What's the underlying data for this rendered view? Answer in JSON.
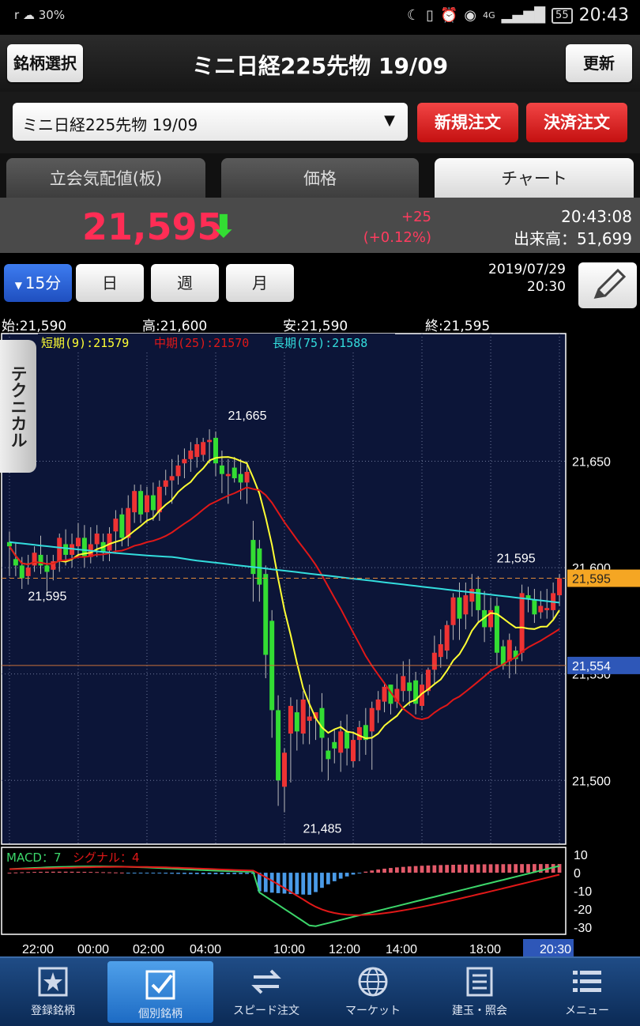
{
  "status": {
    "left": "30%",
    "time": "20:43",
    "battery": "55",
    "net": "4G"
  },
  "header": {
    "left_button": "銘柄選択",
    "title": "ミニ日経225先物 19/09",
    "right_button": "更新"
  },
  "order": {
    "symbol": "ミニ日経225先物 19/09",
    "new_order": "新規注文",
    "settle_order": "決済注文"
  },
  "tabs": [
    {
      "label": "立会気配値(板)"
    },
    {
      "label": "価格"
    },
    {
      "label": "チャート"
    }
  ],
  "quote": {
    "price": "21,595",
    "change": "+25",
    "change_pct": "(+0.12%)",
    "time": "20:43:08",
    "volume": "出来高：51,699"
  },
  "period_buttons": [
    {
      "label": "15分"
    },
    {
      "label": "日"
    },
    {
      "label": "週"
    },
    {
      "label": "月"
    }
  ],
  "chart_date": "2019/07/29",
  "chart_time": "20:30",
  "ohlc": {
    "open": "始:21,590",
    "high": "高:21,600",
    "low": "安:21,590",
    "close": "終:21,595"
  },
  "technical_tab": "テクニカル",
  "legend": {
    "short": "短期(9):21579",
    "mid": "中期(25):21570",
    "long": "長期(75):21588"
  },
  "macd_legend": {
    "macd": "MACD：7",
    "signal": "シグナル：4"
  },
  "colors": {
    "short": "#ffff33",
    "mid": "#e01818",
    "long": "#33dddd",
    "up": "#ee3333",
    "down": "#33dd33",
    "bg": "#0c1538"
  },
  "chart_data": {
    "type": "candlestick",
    "ylim": [
      21470,
      21710
    ],
    "y_ticks": [
      "21,500",
      "21,550",
      "21,600",
      "21,650"
    ],
    "x_ticks": [
      "22:00",
      "00:00",
      "02:00",
      "04:00",
      "10:00",
      "12:00",
      "14:00",
      "18:00",
      "20:30"
    ],
    "current_price_label": "21,595",
    "marker_label": "21,554",
    "annotations": [
      {
        "text": "21,665",
        "x": 38,
        "y": 21665
      },
      {
        "text": "21,595",
        "x": 6,
        "y": 21595
      },
      {
        "text": "21,485",
        "x": 50,
        "y": 21485
      },
      {
        "text": "21,595",
        "x": 81,
        "y": 21598
      }
    ],
    "macd_ticks": [
      "10",
      "0",
      "-10",
      "-20",
      "-30"
    ],
    "candles": [
      [
        21612,
        21610,
        21617,
        21596
      ],
      [
        21604,
        21601,
        21612,
        21596
      ],
      [
        21601,
        21595,
        21605,
        21590
      ],
      [
        21596,
        21600,
        21606,
        21592
      ],
      [
        21601,
        21607,
        21610,
        21598
      ],
      [
        21606,
        21601,
        21615,
        21597
      ],
      [
        21601,
        21598,
        21606,
        21589
      ],
      [
        21599,
        21603,
        21606,
        21594
      ],
      [
        21603,
        21614,
        21616,
        21598
      ],
      [
        21611,
        21606,
        21618,
        21601
      ],
      [
        21606,
        21611,
        21616,
        21600
      ],
      [
        21610,
        21614,
        21621,
        21605
      ],
      [
        21614,
        21605,
        21620,
        21600
      ],
      [
        21605,
        21611,
        21619,
        21602
      ],
      [
        21611,
        21616,
        21620,
        21605
      ],
      [
        21612,
        21607,
        21616,
        21603
      ],
      [
        21608,
        21616,
        21619,
        21603
      ],
      [
        21617,
        21623,
        21627,
        21607
      ],
      [
        21625,
        21614,
        21628,
        21610
      ],
      [
        21614,
        21628,
        21634,
        21610
      ],
      [
        21626,
        21636,
        21639,
        21621
      ],
      [
        21636,
        21625,
        21639,
        21621
      ],
      [
        21626,
        21634,
        21638,
        21621
      ],
      [
        21634,
        21627,
        21640,
        21622
      ],
      [
        21626,
        21638,
        21641,
        21622
      ],
      [
        21638,
        21641,
        21646,
        21634
      ],
      [
        21641,
        21643,
        21651,
        21630
      ],
      [
        21643,
        21648,
        21653,
        21639
      ],
      [
        21649,
        21651,
        21656,
        21642
      ],
      [
        21651,
        21655,
        21659,
        21645
      ],
      [
        21652,
        21658,
        21661,
        21647
      ],
      [
        21653,
        21659,
        21661,
        21650
      ],
      [
        21659,
        21660,
        21665,
        21649
      ],
      [
        21661,
        21649,
        21664,
        21643
      ],
      [
        21648,
        21644,
        21655,
        21635
      ],
      [
        21643,
        21644,
        21651,
        21630
      ],
      [
        21647,
        21642,
        21652,
        21640
      ],
      [
        21644,
        21640,
        21651,
        21632
      ],
      [
        21640,
        21645,
        21650,
        21630
      ],
      [
        21613,
        21597,
        21622,
        21584
      ],
      [
        21609,
        21592,
        21613,
        21584
      ],
      [
        21597,
        21559,
        21601,
        21548
      ],
      [
        21575,
        21533,
        21580,
        21520
      ],
      [
        21533,
        21500,
        21540,
        21488
      ],
      [
        21497,
        21513,
        21515,
        21485
      ],
      [
        21522,
        21535,
        21539,
        21499
      ],
      [
        21532,
        21523,
        21538,
        21514
      ],
      [
        21522,
        21538,
        21542,
        21517
      ],
      [
        21528,
        21530,
        21545,
        21517
      ],
      [
        21529,
        21532,
        21532,
        21519
      ],
      [
        21534,
        21520,
        21541,
        21504
      ],
      [
        21514,
        21510,
        21520,
        21500
      ],
      [
        21518,
        21515,
        21524,
        21508
      ],
      [
        21513,
        21523,
        21528,
        21504
      ],
      [
        21523,
        21515,
        21531,
        21507
      ],
      [
        21509,
        21519,
        21523,
        21506
      ],
      [
        21519,
        21525,
        21528,
        21509
      ],
      [
        21526,
        21519,
        21534,
        21512
      ],
      [
        21523,
        21534,
        21537,
        21505
      ],
      [
        21533,
        21538,
        21542,
        21527
      ],
      [
        21537,
        21544,
        21546,
        21532
      ],
      [
        21545,
        21536,
        21545,
        21531
      ],
      [
        21537,
        21543,
        21550,
        21534
      ],
      [
        21542,
        21549,
        21556,
        21537
      ],
      [
        21546,
        21542,
        21557,
        21535
      ],
      [
        21547,
        21536,
        21551,
        21531
      ],
      [
        21535,
        21545,
        21550,
        21533
      ],
      [
        21542,
        21552,
        21553,
        21540
      ],
      [
        21552,
        21560,
        21568,
        21545
      ],
      [
        21558,
        21564,
        21571,
        21553
      ],
      [
        21561,
        21573,
        21575,
        21557
      ],
      [
        21573,
        21586,
        21588,
        21566
      ],
      [
        21586,
        21576,
        21593,
        21566
      ],
      [
        21578,
        21587,
        21593,
        21571
      ],
      [
        21584,
        21590,
        21597,
        21577
      ],
      [
        21590,
        21580,
        21596,
        21574
      ],
      [
        21580,
        21572,
        21589,
        21565
      ],
      [
        21572,
        21580,
        21586,
        21570
      ],
      [
        21582,
        21560,
        21586,
        21554
      ],
      [
        21563,
        21554,
        21566,
        21552
      ],
      [
        21556,
        21566,
        21569,
        21548
      ],
      [
        21561,
        21557,
        21563,
        21550
      ],
      [
        21560,
        21588,
        21592,
        21556
      ],
      [
        21587,
        21585,
        21591,
        21579
      ],
      [
        21585,
        21578,
        21590,
        21574
      ],
      [
        21579,
        21582,
        21589,
        21576
      ],
      [
        21580,
        21581,
        21590,
        21576
      ],
      [
        21580,
        21588,
        21593,
        21575
      ],
      [
        21587,
        21595,
        21597,
        21582
      ]
    ],
    "series": [
      {
        "name": "短期(9)"
      },
      {
        "name": "中期(25)"
      },
      {
        "name": "長期(75)"
      }
    ]
  },
  "nav": [
    {
      "label": "登録銘柄"
    },
    {
      "label": "個別銘柄"
    },
    {
      "label": "スピード注文"
    },
    {
      "label": "マーケット"
    },
    {
      "label": "建玉・照会"
    },
    {
      "label": "メニュー"
    }
  ]
}
